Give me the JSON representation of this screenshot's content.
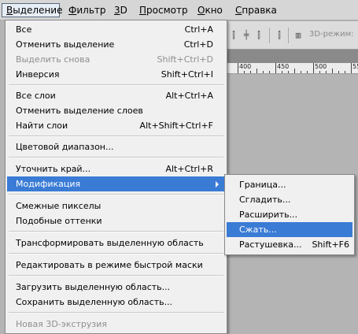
{
  "menubar": {
    "items": [
      {
        "label": "Выделение",
        "u": "В",
        "rest": "ыделение"
      },
      {
        "label": "Фильтр",
        "u": "Ф",
        "rest": "ильтр"
      },
      {
        "label": "3D",
        "u": "3",
        "rest": "D"
      },
      {
        "label": "Просмотр",
        "u": "П",
        "rest": "росмотр"
      },
      {
        "label": "Окно",
        "u": "О",
        "rest": "кно"
      },
      {
        "label": "Справка",
        "u": "С",
        "rest": "правка"
      }
    ]
  },
  "options_bar": {
    "mode_label": "3D-режим:"
  },
  "ruler": {
    "labels": [
      "400",
      "450",
      "500",
      "550"
    ]
  },
  "menu": {
    "items": [
      {
        "label": "Все",
        "shortcut": "Ctrl+A",
        "state": "normal"
      },
      {
        "label": "Отменить выделение",
        "shortcut": "Ctrl+D",
        "state": "normal"
      },
      {
        "label": "Выделить снова",
        "shortcut": "Shift+Ctrl+D",
        "state": "disabled"
      },
      {
        "label": "Инверсия",
        "shortcut": "Shift+Ctrl+I",
        "state": "normal"
      },
      {
        "label": "Все слои",
        "shortcut": "Alt+Ctrl+A",
        "state": "normal"
      },
      {
        "label": "Отменить выделение слоев",
        "shortcut": "",
        "state": "normal"
      },
      {
        "label": "Найти слои",
        "shortcut": "Alt+Shift+Ctrl+F",
        "state": "normal"
      },
      {
        "label": "Цветовой диапазон...",
        "shortcut": "",
        "state": "normal"
      },
      {
        "label": "Уточнить край...",
        "shortcut": "Alt+Ctrl+R",
        "state": "normal"
      },
      {
        "label": "Модификация",
        "shortcut": "",
        "state": "highlighted"
      },
      {
        "label": "Смежные пикселы",
        "shortcut": "",
        "state": "normal"
      },
      {
        "label": "Подобные оттенки",
        "shortcut": "",
        "state": "normal"
      },
      {
        "label": "Трансформировать выделенную область",
        "shortcut": "",
        "state": "normal"
      },
      {
        "label": "Редактировать в режиме быстрой маски",
        "shortcut": "",
        "state": "normal"
      },
      {
        "label": "Загрузить выделенную область...",
        "shortcut": "",
        "state": "normal"
      },
      {
        "label": "Сохранить выделенную область...",
        "shortcut": "",
        "state": "normal"
      },
      {
        "label": "Новая 3D-экструзия",
        "shortcut": "",
        "state": "disabled"
      }
    ]
  },
  "submenu": {
    "items": [
      {
        "label": "Граница...",
        "shortcut": "",
        "state": "normal"
      },
      {
        "label": "Сгладить...",
        "shortcut": "",
        "state": "normal"
      },
      {
        "label": "Расширить...",
        "shortcut": "",
        "state": "normal"
      },
      {
        "label": "Сжать...",
        "shortcut": "",
        "state": "highlighted"
      },
      {
        "label": "Растушевка...",
        "shortcut": "Shift+F6",
        "state": "normal"
      }
    ]
  }
}
